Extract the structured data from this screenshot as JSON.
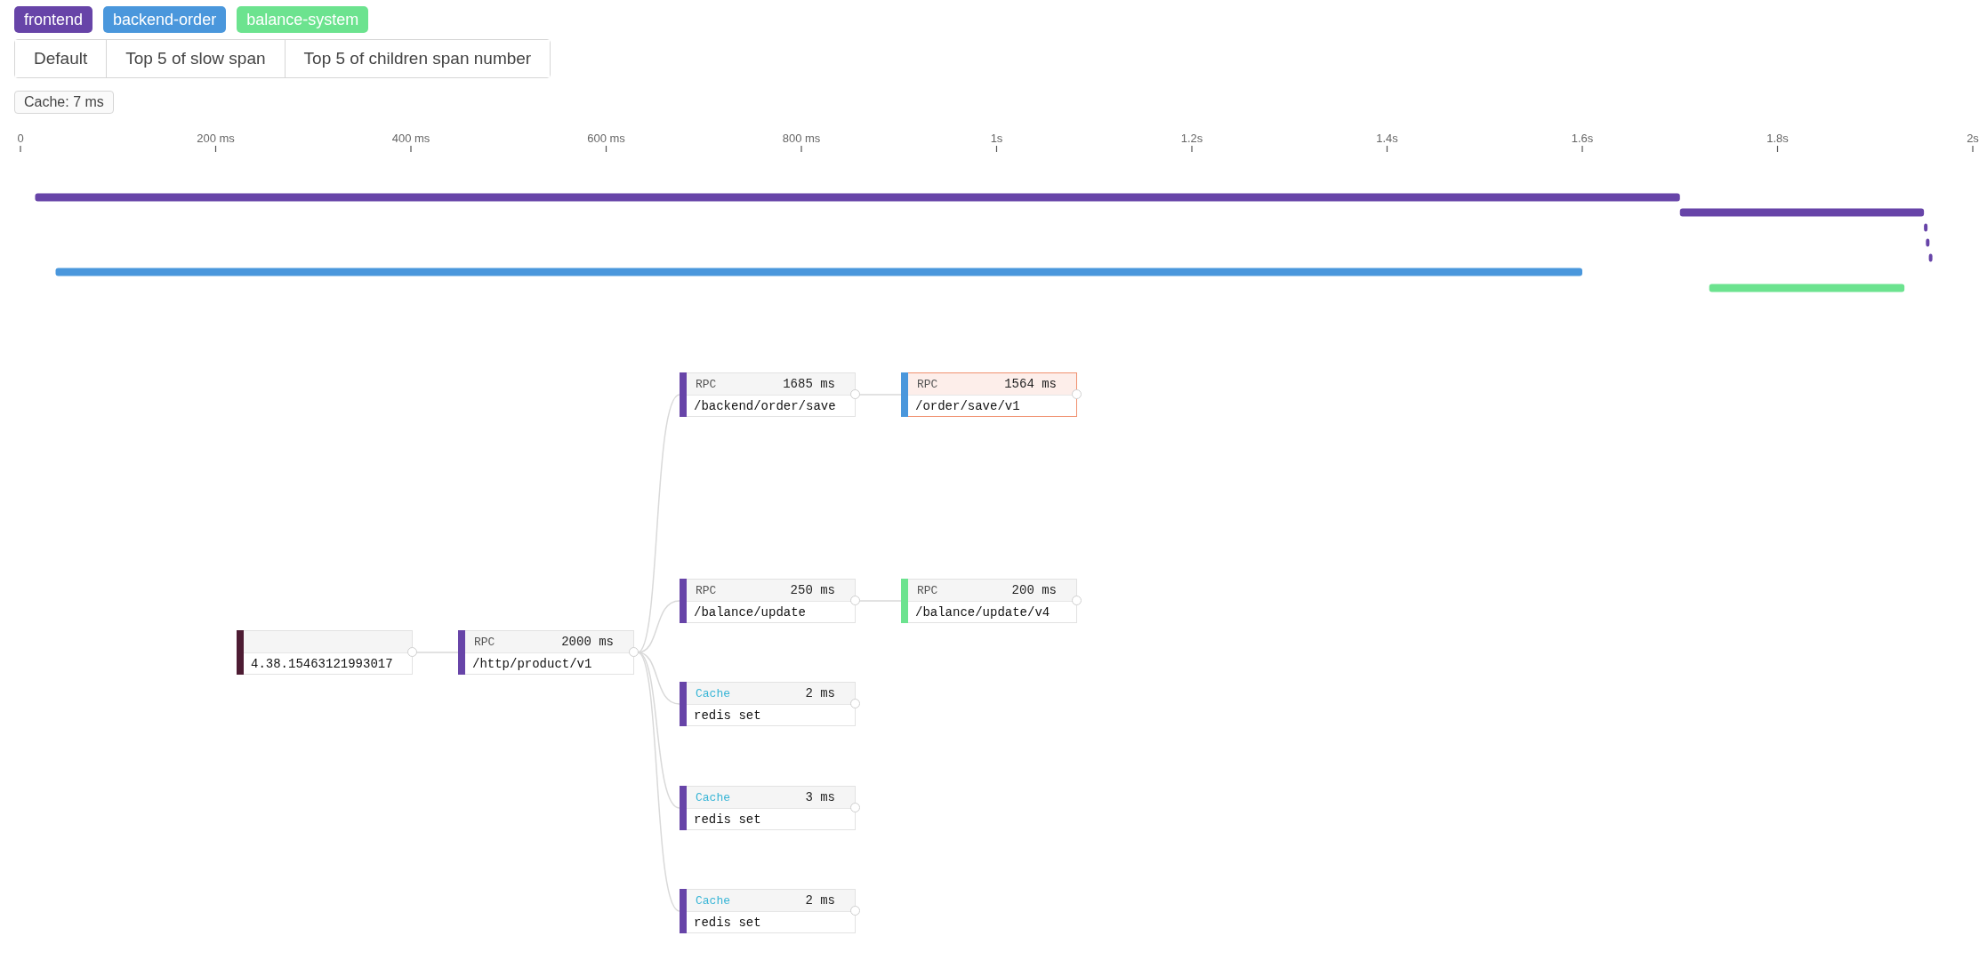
{
  "services": [
    {
      "name": "frontend",
      "color": "#6744a8"
    },
    {
      "name": "backend-order",
      "color": "#4a97dc"
    },
    {
      "name": "balance-system",
      "color": "#6ce38f"
    }
  ],
  "view_tabs": [
    {
      "label": "Default",
      "selected": false
    },
    {
      "label": "Top 5 of slow span",
      "selected": false
    },
    {
      "label": "Top 5 of children span number",
      "selected": false
    }
  ],
  "summary_tag": "Cache: 7 ms",
  "timeline": {
    "tick_labels": [
      "0",
      "200 ms",
      "400 ms",
      "600 ms",
      "800 ms",
      "1s",
      "1.2s",
      "1.4s",
      "1.6s",
      "1.8s",
      "2s"
    ]
  },
  "trace_tree": {
    "kind": "root",
    "label": "4.38.15463121993017",
    "color": "#4d1c33",
    "highlighted": false,
    "children": [
      {
        "kind": "rpc",
        "type": "RPC",
        "duration": "2000 ms",
        "label": "/http/product/v1",
        "color": "#6744a8",
        "highlighted": false,
        "children": [
          {
            "kind": "rpc",
            "type": "RPC",
            "duration": "1685 ms",
            "label": "/backend/order/save",
            "color": "#6744a8",
            "highlighted": false,
            "children": [
              {
                "kind": "rpc",
                "type": "RPC",
                "duration": "1564 ms",
                "label": "/order/save/v1",
                "color": "#4a97dc",
                "highlighted": true
              }
            ]
          },
          {
            "kind": "rpc",
            "type": "RPC",
            "duration": "250 ms",
            "label": "/balance/update",
            "color": "#6744a8",
            "highlighted": false,
            "children": [
              {
                "kind": "rpc",
                "type": "RPC",
                "duration": "200 ms",
                "label": "/balance/update/v4",
                "color": "#6ce38f",
                "highlighted": false
              }
            ]
          },
          {
            "kind": "cache",
            "type": "Cache",
            "duration": "2 ms",
            "label": "redis set",
            "color": "#6744a8",
            "highlighted": false
          },
          {
            "kind": "cache",
            "type": "Cache",
            "duration": "3 ms",
            "label": "redis set",
            "color": "#6744a8",
            "highlighted": false
          },
          {
            "kind": "cache",
            "type": "Cache",
            "duration": "2 ms",
            "label": "redis set",
            "color": "#6744a8",
            "highlighted": false
          }
        ]
      }
    ]
  }
}
